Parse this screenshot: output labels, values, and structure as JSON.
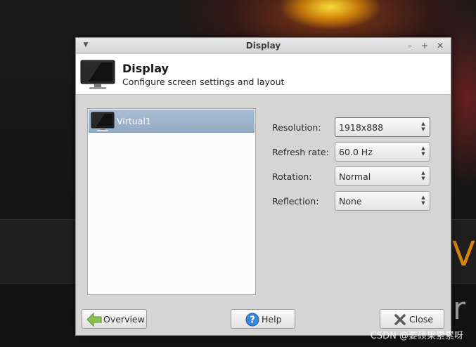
{
  "window": {
    "title": "Display"
  },
  "header": {
    "title": "Display",
    "subtitle": "Configure screen settings and layout"
  },
  "outputs": [
    {
      "label": "Virtual1",
      "selected": true
    }
  ],
  "settings": {
    "resolution": {
      "label": "Resolution:",
      "value": "1918x888"
    },
    "refresh_rate": {
      "label": "Refresh rate:",
      "value": "60.0 Hz"
    },
    "rotation": {
      "label": "Rotation:",
      "value": "Normal"
    },
    "reflection": {
      "label": "Reflection:",
      "value": "None"
    }
  },
  "buttons": {
    "overview": "Overview",
    "help": "Help",
    "close": "Close"
  },
  "desktop": {
    "watermark": "CSDN @要硕果累累呀",
    "letter_v": "V",
    "letter_r": "r"
  },
  "colors": {
    "selection": "#9bb1c9",
    "window_bg": "#d5d5d5",
    "header_bg": "#ffffff",
    "overview_arrow": "#7ab648",
    "help_icon": "#2f7fd0",
    "close_icon": "#555555"
  }
}
